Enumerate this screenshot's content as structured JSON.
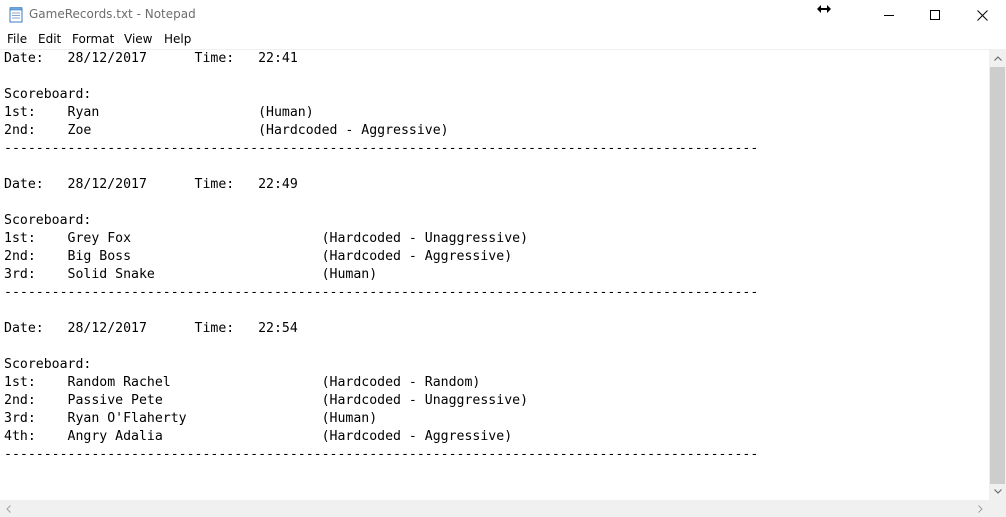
{
  "window": {
    "title": "GameRecords.txt - Notepad"
  },
  "menu": {
    "items": [
      "File",
      "Edit",
      "Format",
      "View",
      "Help"
    ]
  },
  "document": {
    "text": "Date:   28/12/2017      Time:   22:41\n\nScoreboard:\n1st:    Ryan                    (Human)\n2nd:    Zoe                     (Hardcoded - Aggressive)\n-----------------------------------------------------------------------------------------------\n\nDate:   28/12/2017      Time:   22:49\n\nScoreboard:\n1st:    Grey Fox                        (Hardcoded - Unaggressive)\n2nd:    Big Boss                        (Hardcoded - Aggressive)\n3rd:    Solid Snake                     (Human)\n-----------------------------------------------------------------------------------------------\n\nDate:   28/12/2017      Time:   22:54\n\nScoreboard:\n1st:    Random Rachel                   (Hardcoded - Random)\n2nd:    Passive Pete                    (Hardcoded - Unaggressive)\n3rd:    Ryan O'Flaherty                 (Human)\n4th:    Angry Adalia                    (Hardcoded - Aggressive)\n-----------------------------------------------------------------------------------------------"
  },
  "icons": {
    "app": "notepad-icon",
    "cursor": "horizontal-resize-cursor",
    "minimize": "minimize-icon",
    "maximize": "maximize-icon",
    "close": "close-icon",
    "scroll_up": "chevron-up-icon",
    "scroll_down": "chevron-down-icon",
    "scroll_left": "chevron-left-icon",
    "scroll_right": "chevron-right-icon"
  },
  "colors": {
    "title_text": "#6d6d6d",
    "scrollbar_track": "#f0f0f0",
    "scrollbar_thumb": "#cdcdcd"
  }
}
